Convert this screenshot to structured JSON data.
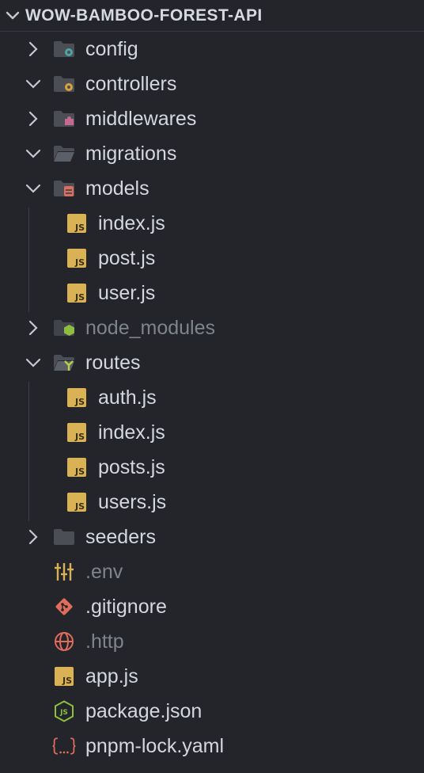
{
  "explorer": {
    "title": "WOW-BAMBOO-FOREST-API"
  },
  "tree": {
    "config": "config",
    "controllers": "controllers",
    "middlewares": "middlewares",
    "migrations": "migrations",
    "models": {
      "label": "models",
      "children": [
        "index.js",
        "post.js",
        "user.js"
      ]
    },
    "node_modules": "node_modules",
    "routes": {
      "label": "routes",
      "children": [
        "auth.js",
        "index.js",
        "posts.js",
        "users.js"
      ]
    },
    "seeders": "seeders",
    "files": [
      ".env",
      ".gitignore",
      ".http",
      "app.js",
      "package.json",
      "pnpm-lock.yaml"
    ]
  },
  "icons": {
    "config": "folder-gear-teal-icon",
    "controllers": "folder-gear-orange-icon",
    "middlewares": "folder-puzzle-icon",
    "migrations": "folder-open-icon",
    "models": "folder-database-icon",
    "node_modules": "folder-node-icon",
    "routes": "folder-routes-icon",
    "seeders": "folder-icon",
    "env": "sliders-icon",
    "gitignore": "git-icon",
    "http": "globe-icon",
    "js": "js-file-icon",
    "package": "nodejs-icon",
    "yaml": "braces-icon"
  },
  "colors": {
    "background": "#23252b",
    "text": "#d4d7de",
    "dim_text": "#7f848c",
    "folder": "#4b4e55",
    "js_badge": "#d9b255",
    "accent_red": "#e06c5c"
  }
}
